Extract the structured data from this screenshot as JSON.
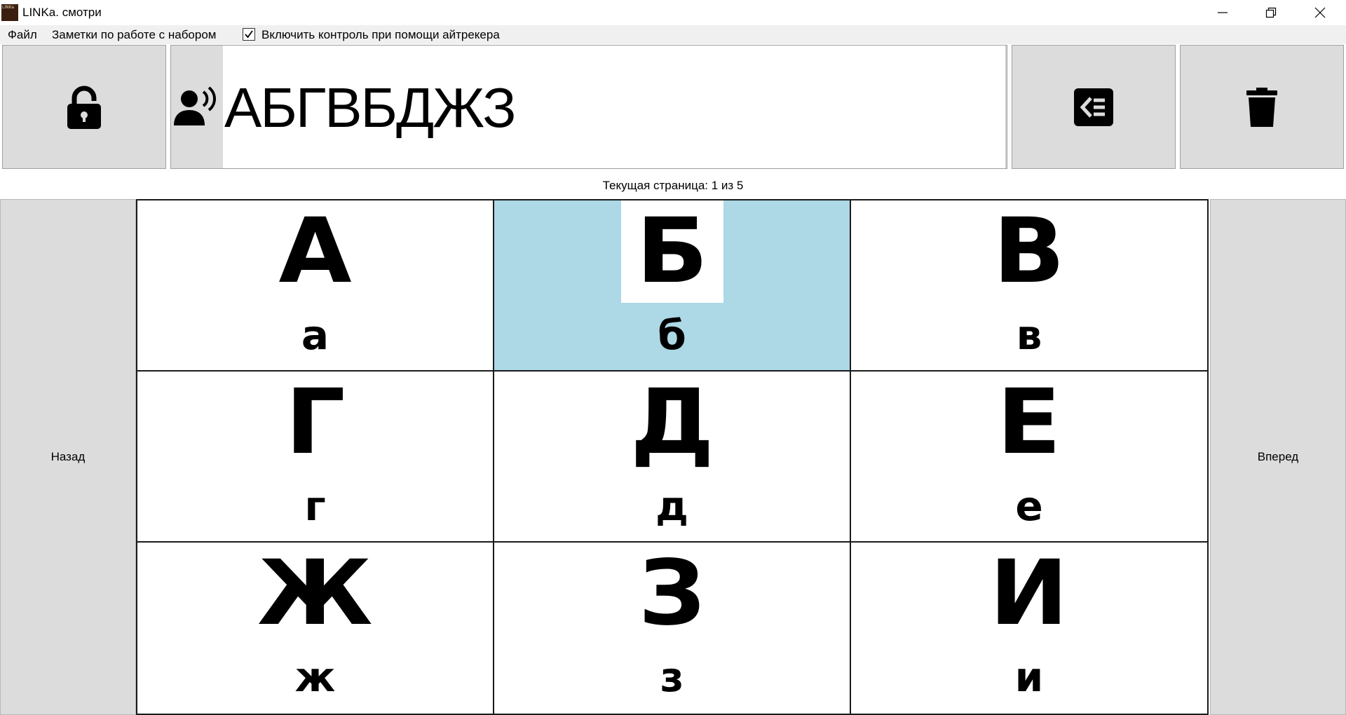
{
  "window": {
    "title": "LINKa. смотри",
    "app_icon_text": "LINKa",
    "controls": [
      "minimize-icon",
      "restore-icon",
      "close-icon"
    ]
  },
  "menu": {
    "file": "Файл",
    "notes": "Заметки по работе с набором",
    "eyetracker_label": "Включить контроль при помощи айтрекера",
    "eyetracker_checked": true
  },
  "toolbar": {
    "lock_icon": "unlock-icon",
    "speak_icon": "speaker-person-icon",
    "typed_text": "АБГВБДЖЗ",
    "backspace_icon": "backspace-icon",
    "clear_icon": "trash-icon"
  },
  "status": {
    "page_text": "Текущая страница: 1 из 5"
  },
  "nav": {
    "back": "Назад",
    "forward": "Вперед"
  },
  "colors": {
    "selected_cell": "#add8e6",
    "button_bg": "#dcdcdc"
  },
  "cards": [
    {
      "upper": "А",
      "lower": "а",
      "selected": false
    },
    {
      "upper": "Б",
      "lower": "б",
      "selected": true
    },
    {
      "upper": "В",
      "lower": "в",
      "selected": false
    },
    {
      "upper": "Г",
      "lower": "г",
      "selected": false
    },
    {
      "upper": "Д",
      "lower": "д",
      "selected": false
    },
    {
      "upper": "Е",
      "lower": "е",
      "selected": false
    },
    {
      "upper": "Ж",
      "lower": "ж",
      "selected": false
    },
    {
      "upper": "З",
      "lower": "з",
      "selected": false
    },
    {
      "upper": "И",
      "lower": "и",
      "selected": false
    }
  ]
}
